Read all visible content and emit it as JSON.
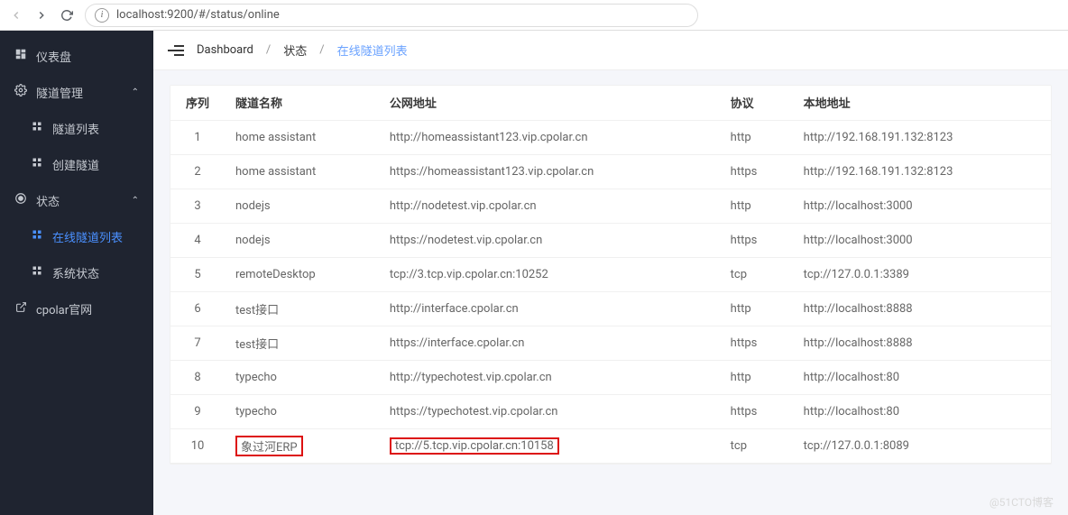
{
  "browser": {
    "url": "localhost:9200/#/status/online"
  },
  "sidebar": {
    "items": [
      {
        "label": "仪表盘",
        "icon": "dashboard"
      },
      {
        "label": "隧道管理",
        "icon": "gear",
        "expand": true
      },
      {
        "label": "隧道列表",
        "icon": "grid",
        "sub": true
      },
      {
        "label": "创建隧道",
        "icon": "grid",
        "sub": true
      },
      {
        "label": "状态",
        "icon": "target",
        "expand": true
      },
      {
        "label": "在线隧道列表",
        "icon": "grid",
        "sub": true,
        "active": true
      },
      {
        "label": "系统状态",
        "icon": "grid",
        "sub": true
      },
      {
        "label": "cpolar官网",
        "icon": "ext"
      }
    ]
  },
  "breadcrumb": {
    "b0": "Dashboard",
    "b1": "状态",
    "b2": "在线隧道列表"
  },
  "table": {
    "headers": {
      "seq": "序列",
      "name": "隧道名称",
      "url": "公网地址",
      "proto": "协议",
      "local": "本地地址"
    },
    "rows": [
      {
        "seq": "1",
        "name": "home assistant",
        "url": "http://homeassistant123.vip.cpolar.cn",
        "proto": "http",
        "local": "http://192.168.191.132:8123"
      },
      {
        "seq": "2",
        "name": "home assistant",
        "url": "https://homeassistant123.vip.cpolar.cn",
        "proto": "https",
        "local": "http://192.168.191.132:8123"
      },
      {
        "seq": "3",
        "name": "nodejs",
        "url": "http://nodetest.vip.cpolar.cn",
        "proto": "http",
        "local": "http://localhost:3000"
      },
      {
        "seq": "4",
        "name": "nodejs",
        "url": "https://nodetest.vip.cpolar.cn",
        "proto": "https",
        "local": "http://localhost:3000"
      },
      {
        "seq": "5",
        "name": "remoteDesktop",
        "url": "tcp://3.tcp.vip.cpolar.cn:10252",
        "proto": "tcp",
        "local": "tcp://127.0.0.1:3389"
      },
      {
        "seq": "6",
        "name": "test接口",
        "url": "http://interface.cpolar.cn",
        "proto": "http",
        "local": "http://localhost:8888"
      },
      {
        "seq": "7",
        "name": "test接口",
        "url": "https://interface.cpolar.cn",
        "proto": "https",
        "local": "http://localhost:8888"
      },
      {
        "seq": "8",
        "name": "typecho",
        "url": "http://typechotest.vip.cpolar.cn",
        "proto": "http",
        "local": "http://localhost:80"
      },
      {
        "seq": "9",
        "name": "typecho",
        "url": "https://typechotest.vip.cpolar.cn",
        "proto": "https",
        "local": "http://localhost:80"
      },
      {
        "seq": "10",
        "name": "象过河ERP",
        "url": "tcp://5.tcp.vip.cpolar.cn:10158",
        "proto": "tcp",
        "local": "tcp://127.0.0.1:8089",
        "hl": true
      }
    ]
  },
  "watermark": "@51CTO博客"
}
